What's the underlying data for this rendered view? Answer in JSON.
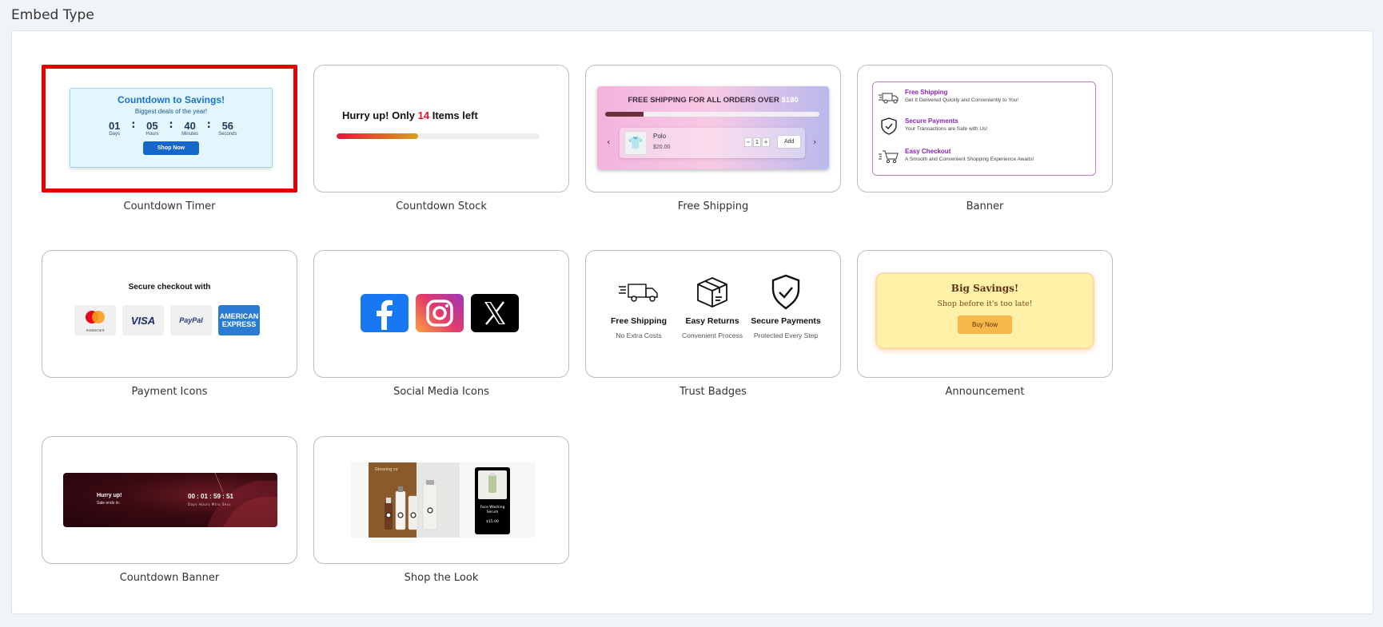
{
  "section_title": "Embed Type",
  "tiles": {
    "countdown_timer": {
      "label": "Countdown Timer",
      "preview": {
        "title": "Countdown to Savings!",
        "subtitle": "Biggest deals of the year!",
        "days": "01",
        "hours": "05",
        "minutes": "40",
        "seconds": "56",
        "days_label": "Days",
        "hours_label": "Hours",
        "minutes_label": "Minutes",
        "seconds_label": "Seconds",
        "button": "Shop Now"
      }
    },
    "countdown_stock": {
      "label": "Countdown Stock",
      "preview": {
        "text_before": "Hurry up! Only ",
        "count": "14",
        "text_after": " Items left",
        "progress": 0.4
      }
    },
    "free_shipping": {
      "label": "Free Shipping",
      "preview": {
        "title": "FREE SHIPPING FOR ALL ORDERS OVER ",
        "amount": "$180",
        "progress": 0.18,
        "product_name": "Polo",
        "product_price": "$20.00",
        "qty": "1",
        "minus": "−",
        "plus": "+",
        "add_button": "Add",
        "prev": "‹",
        "next": "›"
      }
    },
    "banner": {
      "label": "Banner",
      "preview": {
        "items": [
          {
            "heading": "Free Shipping",
            "desc": "Get It Delivered Quickly and Conveniently to You!",
            "icon": "truck-icon"
          },
          {
            "heading": "Secure Payments",
            "desc": "Your Transactions are Safe with Us!",
            "icon": "shield-check-icon"
          },
          {
            "heading": "Easy Checkout",
            "desc": "A Smooth and Convenient Shopping Experience Awaits!",
            "icon": "cart-icon"
          }
        ]
      }
    },
    "payment_icons": {
      "label": "Payment Icons",
      "preview": {
        "title": "Secure checkout with",
        "mastercard": "mastercard",
        "visa": "VISA",
        "paypal": "PayPal",
        "amex_line1": "AMERICAN",
        "amex_line2": "EXPRESS"
      }
    },
    "social_media_icons": {
      "label": "Social Media Icons",
      "preview": {
        "icons": [
          "facebook-icon",
          "instagram-icon",
          "x-icon"
        ]
      }
    },
    "trust_badges": {
      "label": "Trust Badges",
      "preview": {
        "items": [
          {
            "heading": "Free Shipping",
            "desc": "No Extra Costs",
            "icon": "truck-icon"
          },
          {
            "heading": "Easy Returns",
            "desc": "Convenient Process",
            "icon": "box-icon"
          },
          {
            "heading": "Secure Payments",
            "desc": "Protected Every Step",
            "icon": "shield-check-icon"
          }
        ]
      }
    },
    "announcement": {
      "label": "Announcement",
      "preview": {
        "title": "Big Savings!",
        "subtitle": "Shop before it's too late!",
        "button": "Buy Now"
      }
    },
    "countdown_banner": {
      "label": "Countdown Banner",
      "preview": {
        "title": "Hurry up!",
        "subtitle": "Sale ends in:",
        "time": "00 : 01 : 59 : 51",
        "units": "Days   Hours   Mins   Secs"
      }
    },
    "shop_the_look": {
      "label": "Shop the Look",
      "preview": {
        "brand": "Glossing co",
        "overlay_text": "Face Washing Serum",
        "price": "$15.00"
      }
    }
  },
  "colors": {
    "selected_border": "#e00000",
    "card_border": "#b9bdc2",
    "page_bg": "#f1f4f7"
  }
}
